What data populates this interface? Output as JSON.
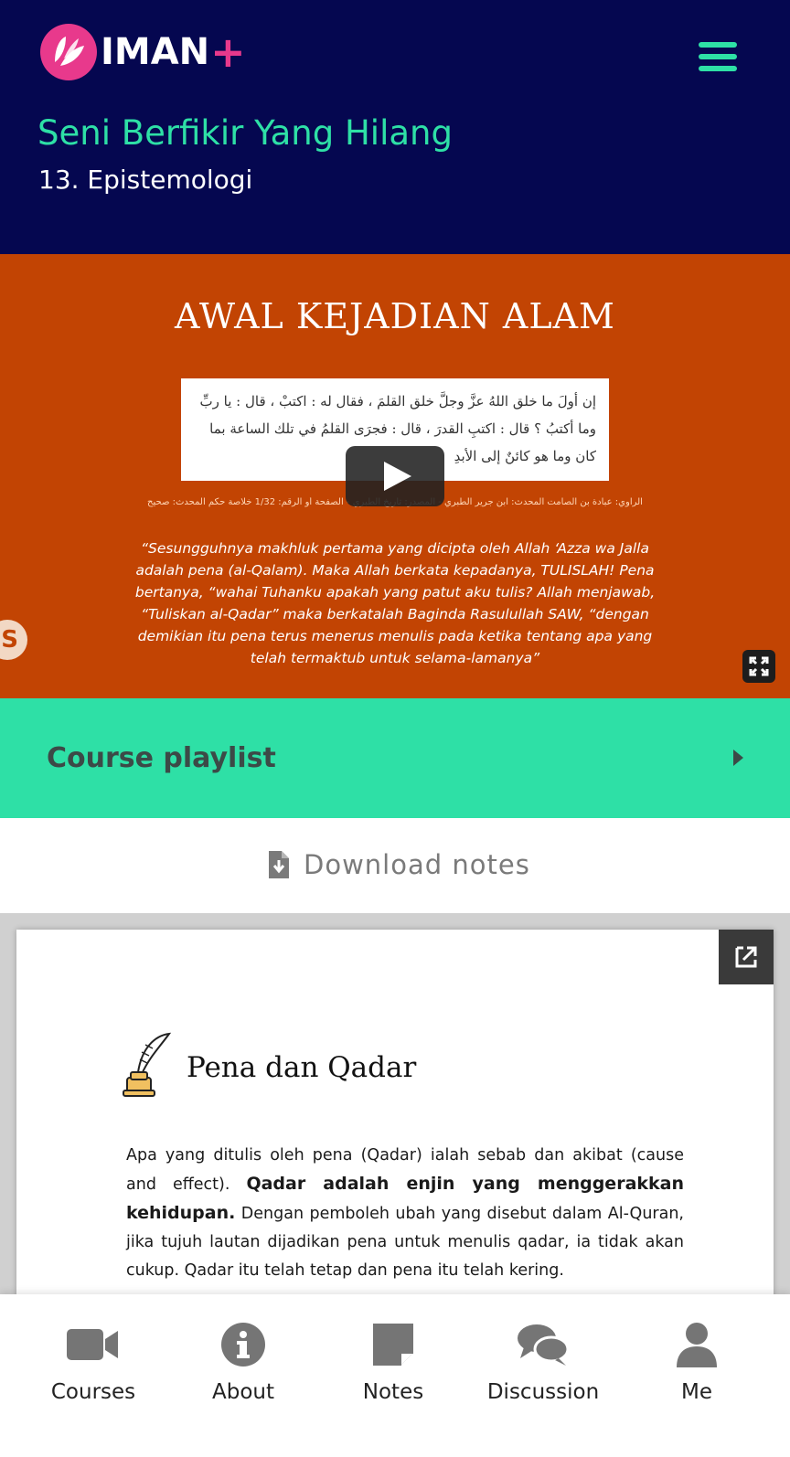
{
  "header": {
    "brand": "IMAN",
    "brand_plus": "+",
    "course_title": "Seni Berfikir Yang Hilang",
    "lesson_title": "13. Epistemologi"
  },
  "video": {
    "slide_title": "AWAL KEJADIAN ALAM",
    "arabic_text": "إن أولَ ما خلق اللهُ عزَّ وجلَّ خلق القلمَ ، فقال له : اكتبْ ، قال : يا ربِّ وما أكتبُ ؟ قال : اكتبِ القدرَ ، قال : فجرَى القلمُ في تلك الساعة بما كان وما هو كائنٌ إلى الأبدِ",
    "narrator_line": "الراوي: عبادة بن الصامت المحدث: ابن جرير الطبري - المصدر: تاريخ الطبري - الصفحة أو الرقم: 1/32 خلاصة حكم المحدث: صحيح",
    "translation": "“Sesungguhnya makhluk pertama yang dicipta oleh Allah ‘Azza wa Jalla  adalah pena (al-Qalam). Maka Allah berkata kepadanya, TULISLAH! Pena bertanya, “wahai Tuhanku apakah yang patut aku tulis? Allah menjawab, “Tuliskan al-Qadar” maka berkatalah Baginda Rasulullah SAW, “dengan demikian itu pena terus menerus menulis pada ketika tentang apa yang telah termaktub untuk selama-lamanya”",
    "side_badge": "S"
  },
  "playlist": {
    "label": "Course playlist"
  },
  "download": {
    "label": "Download notes"
  },
  "notes": {
    "heading": "Pena dan Qadar",
    "body_part1": "Apa yang ditulis oleh pena (Qadar) ialah sebab dan akibat (cause and effect). ",
    "body_bold": "Qadar adalah enjin yang menggerakkan kehidupan.",
    "body_part2": " Dengan pemboleh ubah yang disebut dalam Al-Quran, jika tujuh lautan dijadikan pena untuk menulis qadar, ia tidak akan cukup. Qadar itu telah tetap dan pena itu telah kering."
  },
  "nav": {
    "items": [
      {
        "label": "Courses",
        "icon": "video-camera-icon"
      },
      {
        "label": "About",
        "icon": "info-icon"
      },
      {
        "label": "Notes",
        "icon": "sticky-note-icon"
      },
      {
        "label": "Discussion",
        "icon": "chat-bubbles-icon"
      },
      {
        "label": "Me",
        "icon": "user-icon"
      }
    ]
  },
  "colors": {
    "header_bg": "#050750",
    "accent": "#2ee0a6",
    "brand_pink": "#e8398c",
    "video_bg": "#c24403",
    "nav_icon": "#757575"
  }
}
